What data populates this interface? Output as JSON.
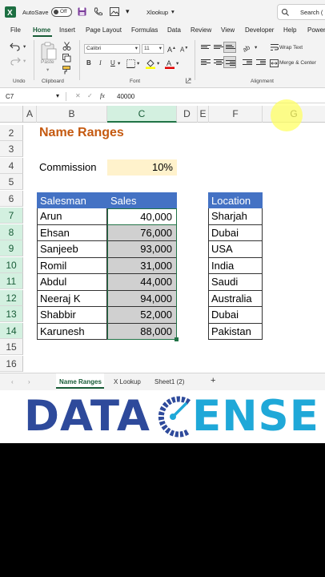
{
  "titlebar": {
    "autosave_label": "AutoSave",
    "autosave_state": "Off",
    "file_name": "Xlookup",
    "search_placeholder": "Search ("
  },
  "menu": [
    "File",
    "Home",
    "Insert",
    "Page Layout",
    "Formulas",
    "Data",
    "Review",
    "View",
    "Developer",
    "Help",
    "Power"
  ],
  "ribbon": {
    "font_name": "Calibri",
    "font_size": "11",
    "paste_label": "Paste",
    "wrap_text": "Wrap Text",
    "merge_center": "Merge & Center",
    "groups": {
      "undo": "Undo",
      "clipboard": "Clipboard",
      "font": "Font",
      "alignment": "Alignment"
    }
  },
  "formula_bar": {
    "name_box": "C7",
    "fx": "fx",
    "value": "40000"
  },
  "columns": [
    "A",
    "B",
    "C",
    "D",
    "E",
    "F",
    "G"
  ],
  "rows": [
    "2",
    "3",
    "4",
    "5",
    "6",
    "7",
    "8",
    "9",
    "10",
    "11",
    "12",
    "13",
    "14",
    "15",
    "16"
  ],
  "sheet": {
    "title": "Name Ranges",
    "commission_label": "Commission",
    "commission_value": "10%",
    "headers": {
      "salesman": "Salesman",
      "sales": "Sales",
      "location": "Location"
    },
    "records": [
      {
        "salesman": "Arun",
        "sales": "40,000",
        "location": "Sharjah"
      },
      {
        "salesman": "Ehsan",
        "sales": "76,000",
        "location": "Dubai"
      },
      {
        "salesman": "Sanjeeb",
        "sales": "93,000",
        "location": "USA"
      },
      {
        "salesman": "Romil",
        "sales": "31,000",
        "location": "India"
      },
      {
        "salesman": "Abdul",
        "sales": "44,000",
        "location": "Saudi"
      },
      {
        "salesman": "Neeraj K",
        "sales": "94,000",
        "location": "Australia"
      },
      {
        "salesman": "Shabbir",
        "sales": "52,000",
        "location": "Dubai"
      },
      {
        "salesman": "Karunesh",
        "sales": "88,000",
        "location": "Pakistan"
      }
    ]
  },
  "tabs": [
    "Name Ranges",
    "X Lookup",
    "Sheet1 (2)"
  ],
  "tab_add": "+",
  "logo": {
    "part1": "DATA",
    "part2": "ENSE"
  },
  "colors": {
    "accent": "#185c37",
    "header_blue": "#4472c4",
    "title_orange": "#c55a11",
    "commission_fill": "#fff2cc",
    "logo_blue": "#2e4a9b",
    "logo_cyan": "#1fa8d8"
  }
}
